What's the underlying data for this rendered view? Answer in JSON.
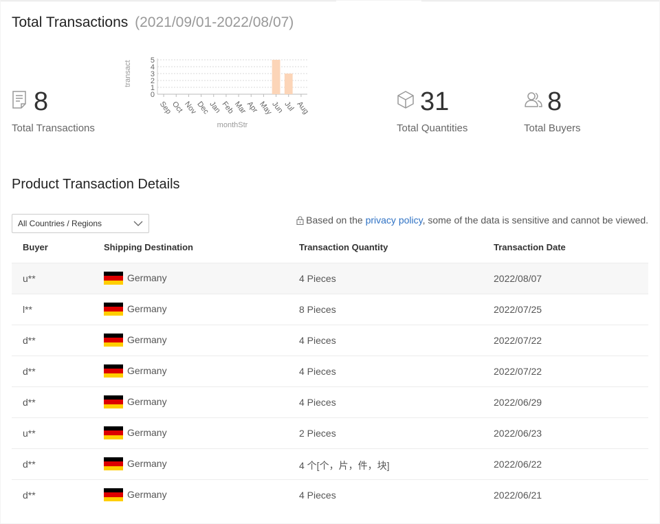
{
  "header": {
    "title": "Total Transactions",
    "date_range": "(2021/09/01-2022/08/07)"
  },
  "stats": {
    "total_transactions": {
      "value": "8",
      "label": "Total Transactions",
      "icon": "document-icon"
    },
    "total_quantities": {
      "value": "31",
      "label": "Total Quantities",
      "icon": "box-icon"
    },
    "total_buyers": {
      "value": "8",
      "label": "Total Buyers",
      "icon": "users-icon"
    }
  },
  "chart_data": {
    "type": "bar",
    "categories": [
      "Sep",
      "Oct",
      "Nov",
      "Dec",
      "Jan",
      "Feb",
      "Mar",
      "Apr",
      "May",
      "Jun",
      "Jul",
      "Aug"
    ],
    "values": [
      0,
      0,
      0,
      0,
      0,
      0,
      0,
      0,
      0,
      5,
      3,
      0
    ],
    "xlabel": "monthStr",
    "ylabel": "transact",
    "ylim": [
      0,
      5
    ],
    "yticks": [
      "0",
      "1",
      "2",
      "3",
      "4",
      "5"
    ],
    "grid": true,
    "bar_color": "#fcd5b8"
  },
  "details": {
    "title": "Product Transaction Details",
    "filter": {
      "selected": "All Countries / Regions"
    },
    "privacy": {
      "prefix": "Based on the",
      "link": "privacy policy",
      "suffix": ", some of the data is sensitive and cannot be viewed."
    },
    "columns": {
      "buyer": "Buyer",
      "destination": "Shipping Destination",
      "quantity": "Transaction Quantity",
      "date": "Transaction Date"
    },
    "rows": [
      {
        "buyer": "u**",
        "destination": "Germany",
        "quantity": "4 Pieces",
        "date": "2022/08/07"
      },
      {
        "buyer": "l**",
        "destination": "Germany",
        "quantity": "8 Pieces",
        "date": "2022/07/25"
      },
      {
        "buyer": "d**",
        "destination": "Germany",
        "quantity": "4 Pieces",
        "date": "2022/07/22"
      },
      {
        "buyer": "d**",
        "destination": "Germany",
        "quantity": "4 Pieces",
        "date": "2022/07/22"
      },
      {
        "buyer": "d**",
        "destination": "Germany",
        "quantity": "4 Pieces",
        "date": "2022/06/29"
      },
      {
        "buyer": "u**",
        "destination": "Germany",
        "quantity": "2 Pieces",
        "date": "2022/06/23"
      },
      {
        "buyer": "d**",
        "destination": "Germany",
        "quantity": "4 个[个，片，件，块]",
        "date": "2022/06/22"
      },
      {
        "buyer": "d**",
        "destination": "Germany",
        "quantity": "4 Pieces",
        "date": "2022/06/21"
      }
    ]
  },
  "colors": {
    "flag_black": "#000000",
    "flag_red": "#dd0000",
    "flag_gold": "#ffce00",
    "link": "#2f72c4"
  }
}
